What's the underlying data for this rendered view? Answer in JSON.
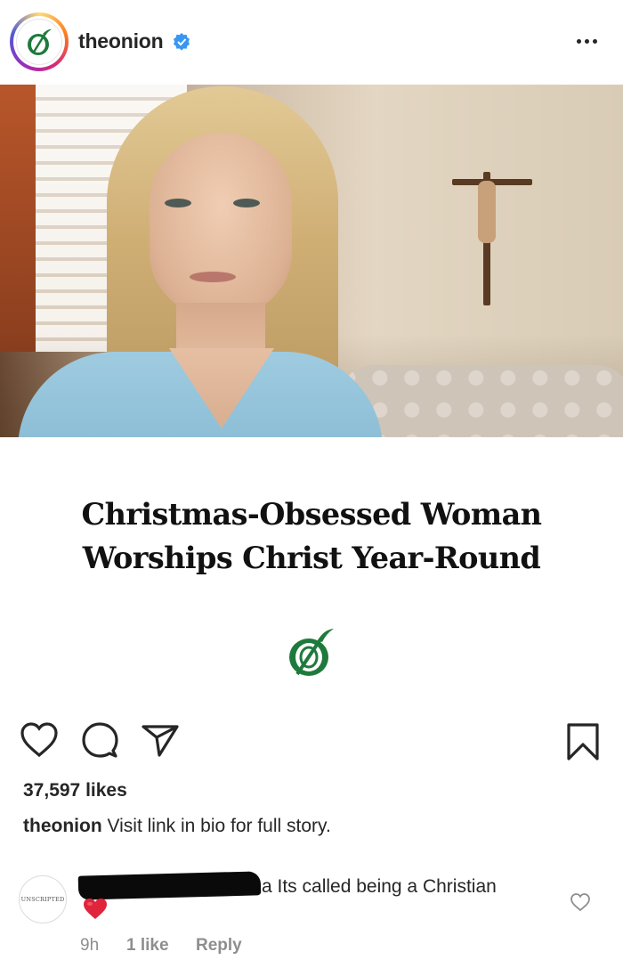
{
  "post": {
    "username": "theonion",
    "verified": true,
    "headline_line1": "Christmas-Obsessed Woman",
    "headline_line2": "Worships Christ Year-Round"
  },
  "engagement": {
    "likes": "37,597 likes",
    "caption_user": "theonion",
    "caption_text": " Visit link in bio for full story."
  },
  "comment": {
    "avatar_text": "UNSCRIPTED",
    "text": "a Its called being a Christian",
    "emoji": "❤️",
    "time": "9h",
    "likes": "1 like",
    "reply_label": "Reply"
  },
  "colors": {
    "onion_green": "#1e7a3c",
    "verified_blue": "#3897f0",
    "heart_red": "#e0243b"
  }
}
